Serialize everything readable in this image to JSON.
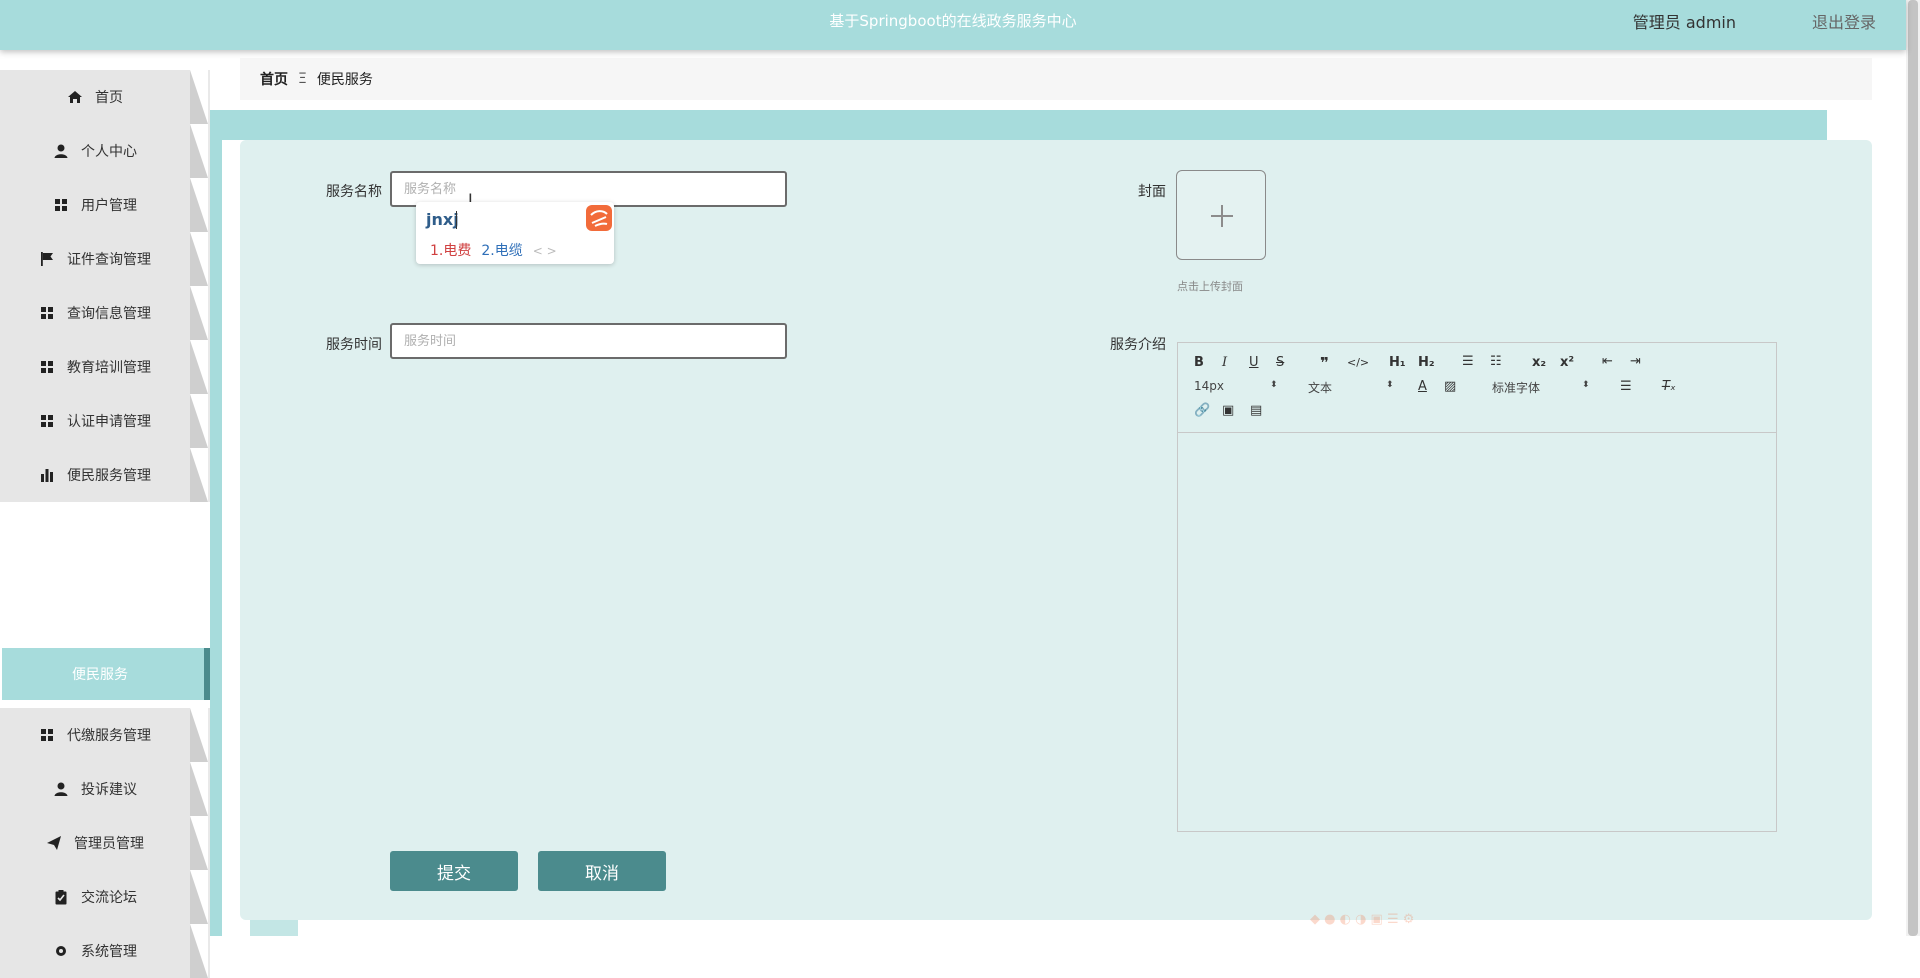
{
  "header": {
    "title": "基于Springboot的在线政务服务中心",
    "user": "管理员 admin",
    "logout": "退出登录"
  },
  "sidebar": {
    "items": [
      {
        "label": "首页",
        "icon": "home-icon"
      },
      {
        "label": "个人中心",
        "icon": "user-icon"
      },
      {
        "label": "用户管理",
        "icon": "grid-icon"
      },
      {
        "label": "证件查询管理",
        "icon": "flag-icon"
      },
      {
        "label": "查询信息管理",
        "icon": "grid-icon"
      },
      {
        "label": "教育培训管理",
        "icon": "grid-icon"
      },
      {
        "label": "认证申请管理",
        "icon": "grid-icon"
      },
      {
        "label": "便民服务管理",
        "icon": "bar-chart-icon"
      },
      {
        "label": "代缴服务管理",
        "icon": "grid-icon"
      },
      {
        "label": "投诉建议",
        "icon": "user-icon"
      },
      {
        "label": "管理员管理",
        "icon": "send-icon"
      },
      {
        "label": "交流论坛",
        "icon": "clipboard-icon"
      },
      {
        "label": "系统管理",
        "icon": "settings-icon"
      }
    ],
    "active_sub": "便民服务"
  },
  "breadcrumb": {
    "home": "首页",
    "current": "便民服务"
  },
  "form": {
    "name_label": "服务名称",
    "name_placeholder": "服务名称",
    "time_label": "服务时间",
    "time_placeholder": "服务时间",
    "cover_label": "封面",
    "cover_tip": "点击上传封面",
    "intro_label": "服务介绍",
    "submit": "提交",
    "cancel": "取消"
  },
  "ime": {
    "composition": "jnxj",
    "candidate1": "1.电费",
    "candidate2": "2.电缆",
    "nav": "< >"
  },
  "editor": {
    "font_size": "14px",
    "block_format": "文本",
    "font_family": "标准字体"
  },
  "colors": {
    "header_bg": "#a7dcdc",
    "panel_bg": "#dff0ef",
    "button_bg": "#4b8b8d"
  }
}
